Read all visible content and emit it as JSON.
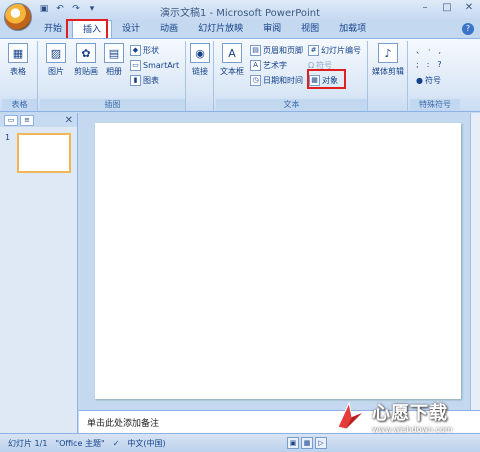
{
  "window": {
    "title": "演示文稿1 - Microsoft PowerPoint",
    "controls": [
      "–",
      "□",
      "✕"
    ]
  },
  "qat": [
    "save-icon",
    "undo-icon",
    "redo-icon",
    "customize-icon"
  ],
  "tabs": [
    "开始",
    "插入",
    "设计",
    "动画",
    "幻灯片放映",
    "审阅",
    "视图",
    "加载项"
  ],
  "active_tab": "插入",
  "ribbon": {
    "groups": {
      "tables": {
        "label": "表格",
        "table_btn": "表格"
      },
      "illustrations": {
        "label": "插图",
        "picture": "图片",
        "clipart": "剪贴画",
        "album": "相册",
        "shapes": "形状",
        "smartart": "SmartArt",
        "chart": "图表"
      },
      "links": {
        "link": "链接"
      },
      "text": {
        "label": "文本",
        "textbox": "文本框",
        "header_footer": "页眉和页脚",
        "wordart": "艺术字",
        "datetime": "日期和时间",
        "slide_number": "幻灯片编号",
        "symbol": "符号",
        "object": "对象"
      },
      "media": {
        "media_clip": "媒体剪辑"
      },
      "special": {
        "label": "特殊符号",
        "symbol": "符号"
      }
    }
  },
  "panel": {
    "slide_number": "1"
  },
  "notes": {
    "placeholder": "单击此处添加备注"
  },
  "status": {
    "slide": "幻灯片 1/1",
    "theme": "\"Office 主题\"",
    "language": "中文(中国)"
  },
  "watermark": {
    "brand": "心愿下载",
    "url": "www.wishdown.com"
  }
}
